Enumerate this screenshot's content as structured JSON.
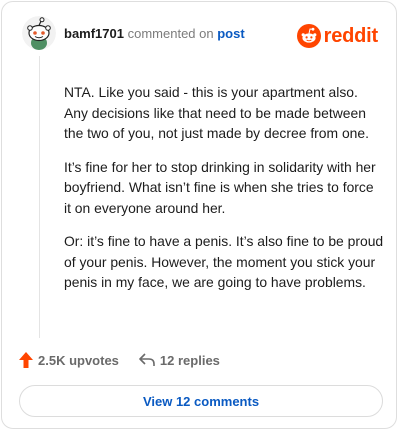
{
  "comment": {
    "username": "bamf1701",
    "commented_text": "commented on",
    "post_link": "post",
    "paragraphs": [
      "NTA. Like you said - this is your apartment also. Any decisions like that need to be made between the two of you, not just made by decree from one.",
      "It’s fine for her to stop drinking in solidarity with her boyfriend. What isn’t fine is when she tries to force it on everyone around her.",
      "Or: it’s fine to have a penis. It’s also fine to be proud of your penis. However, the moment you stick your penis in my face, we are going to have problems."
    ]
  },
  "brand": {
    "logo_text": "reddit",
    "color": "#ff4500"
  },
  "actions": {
    "upvotes": "2.5K upvotes",
    "replies": "12 replies"
  },
  "view_button": {
    "label": "View 12 comments"
  },
  "colors": {
    "link": "#0a5ac2",
    "upvote": "#ff4500",
    "muted": "#7c7c7c"
  },
  "icons": [
    "avatar-snoo-icon",
    "reddit-logo-icon",
    "upvote-arrow-icon",
    "reply-arrow-icon"
  ]
}
